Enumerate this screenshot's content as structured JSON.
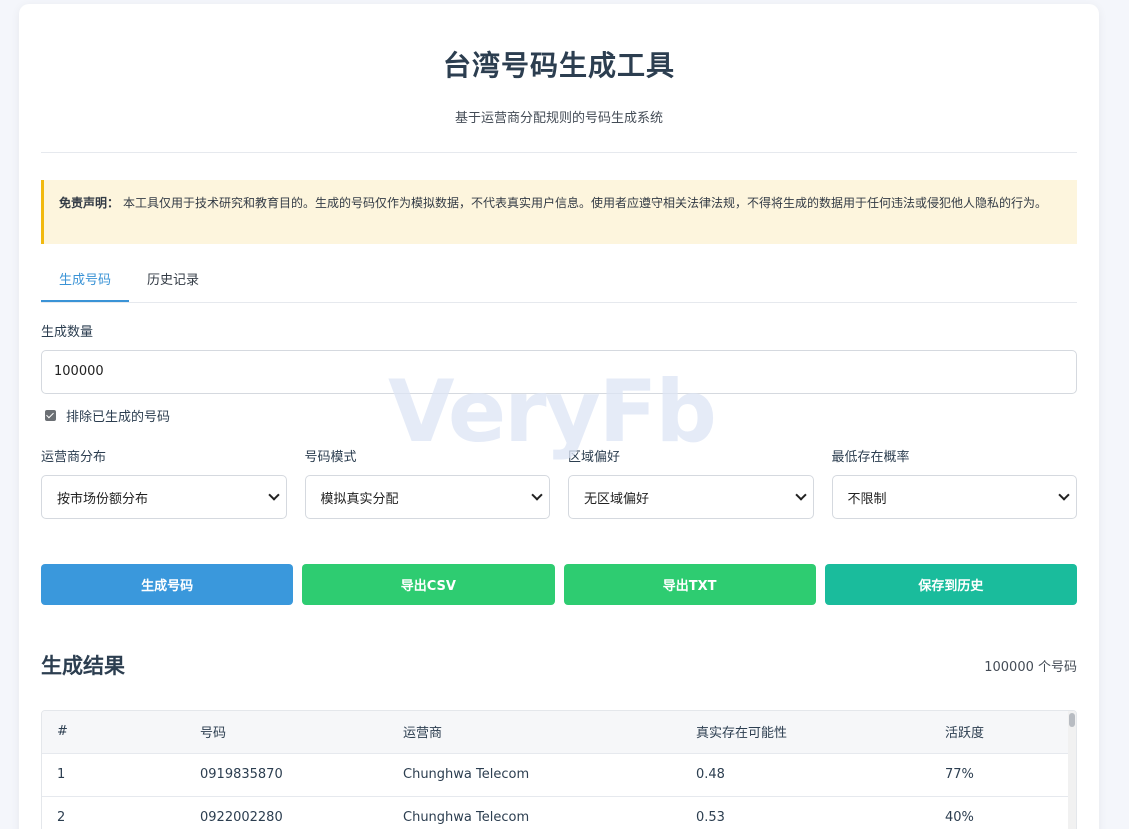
{
  "header": {
    "title": "台湾号码生成工具",
    "subtitle": "基于运营商分配规则的号码生成系统"
  },
  "disclaimer": {
    "label": "免责声明：",
    "text": "本工具仅用于技术研究和教育目的。生成的号码仅作为模拟数据，不代表真实用户信息。使用者应遵守相关法律法规，不得将生成的数据用于任何违法或侵犯他人隐私的行为。"
  },
  "tabs": [
    {
      "label": "生成号码",
      "active": true
    },
    {
      "label": "历史记录",
      "active": false
    }
  ],
  "form": {
    "quantity_label": "生成数量",
    "quantity_value": "100000",
    "exclude_label": "排除已生成的号码",
    "exclude_checked": true,
    "selects": [
      {
        "label": "运营商分布",
        "value": "按市场份额分布"
      },
      {
        "label": "号码模式",
        "value": "模拟真实分配"
      },
      {
        "label": "区域偏好",
        "value": "无区域偏好"
      },
      {
        "label": "最低存在概率",
        "value": "不限制"
      }
    ]
  },
  "buttons": {
    "generate": "生成号码",
    "export_csv": "导出CSV",
    "export_txt": "导出TXT",
    "save_history": "保存到历史"
  },
  "results": {
    "title": "生成结果",
    "count": "100000 个号码",
    "columns": [
      "#",
      "号码",
      "运营商",
      "真实存在可能性",
      "活跃度"
    ],
    "rows": [
      [
        "1",
        "0919835870",
        "Chunghwa Telecom",
        "0.48",
        "77%"
      ],
      [
        "2",
        "0922002280",
        "Chunghwa Telecom",
        "0.53",
        "40%"
      ]
    ]
  },
  "watermark": "VeryFb",
  "colors": {
    "accent_blue": "#3a98dc",
    "accent_green": "#2ecc71",
    "accent_teal": "#1abc9c",
    "warning_border": "#f1b90f",
    "warning_bg": "#fdf5dd"
  }
}
